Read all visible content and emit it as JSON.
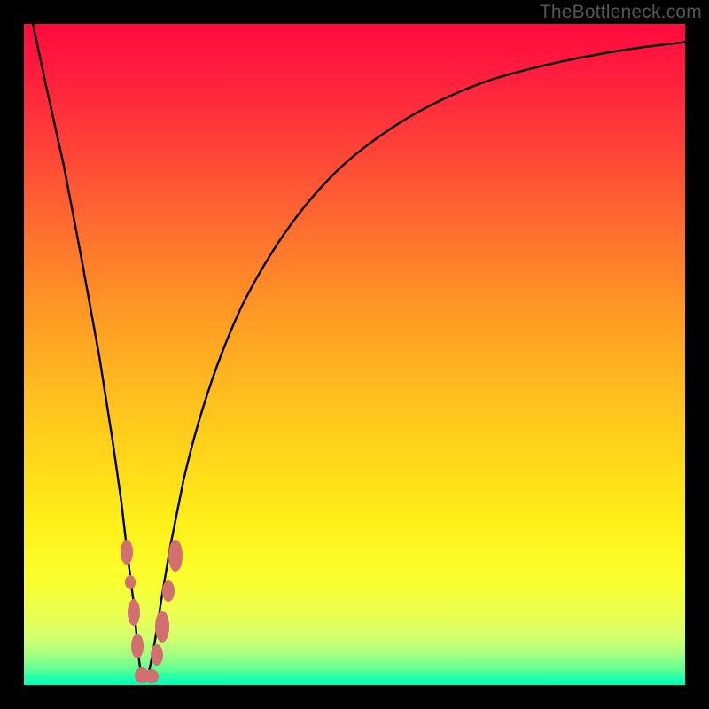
{
  "watermark": "TheBottleneck.com",
  "chart_data": {
    "type": "line",
    "title": "",
    "xlabel": "",
    "ylabel": "",
    "xlim": [
      0,
      100
    ],
    "ylim": [
      0,
      100
    ],
    "series": [
      {
        "name": "bottleneck-curve",
        "x": [
          0,
          2,
          4,
          6,
          8,
          10,
          12,
          14,
          15,
          16,
          17,
          18,
          19,
          20,
          22,
          24,
          27,
          30,
          35,
          40,
          45,
          50,
          55,
          60,
          65,
          70,
          75,
          80,
          85,
          90,
          95,
          100
        ],
        "y": [
          100,
          90,
          80,
          70,
          60,
          50,
          40,
          25,
          15,
          6,
          1,
          1,
          6,
          15,
          28,
          40,
          52,
          60,
          70,
          76,
          80,
          83.5,
          86,
          88,
          89.5,
          90.8,
          91.8,
          92.6,
          93.3,
          93.8,
          94.2,
          94.5
        ]
      }
    ],
    "annotations": {
      "minimum_x": 17.5,
      "minimum_y": 0,
      "bead_cluster_x_range": [
        13.5,
        22.0
      ],
      "bead_cluster_y_range": [
        0,
        24
      ]
    }
  },
  "colors": {
    "background_top": "#ff0a3e",
    "background_bottom": "#00ffb9",
    "curve": "#000000",
    "beads": "#d1706e",
    "frame": "#000000",
    "watermark": "#555555"
  }
}
